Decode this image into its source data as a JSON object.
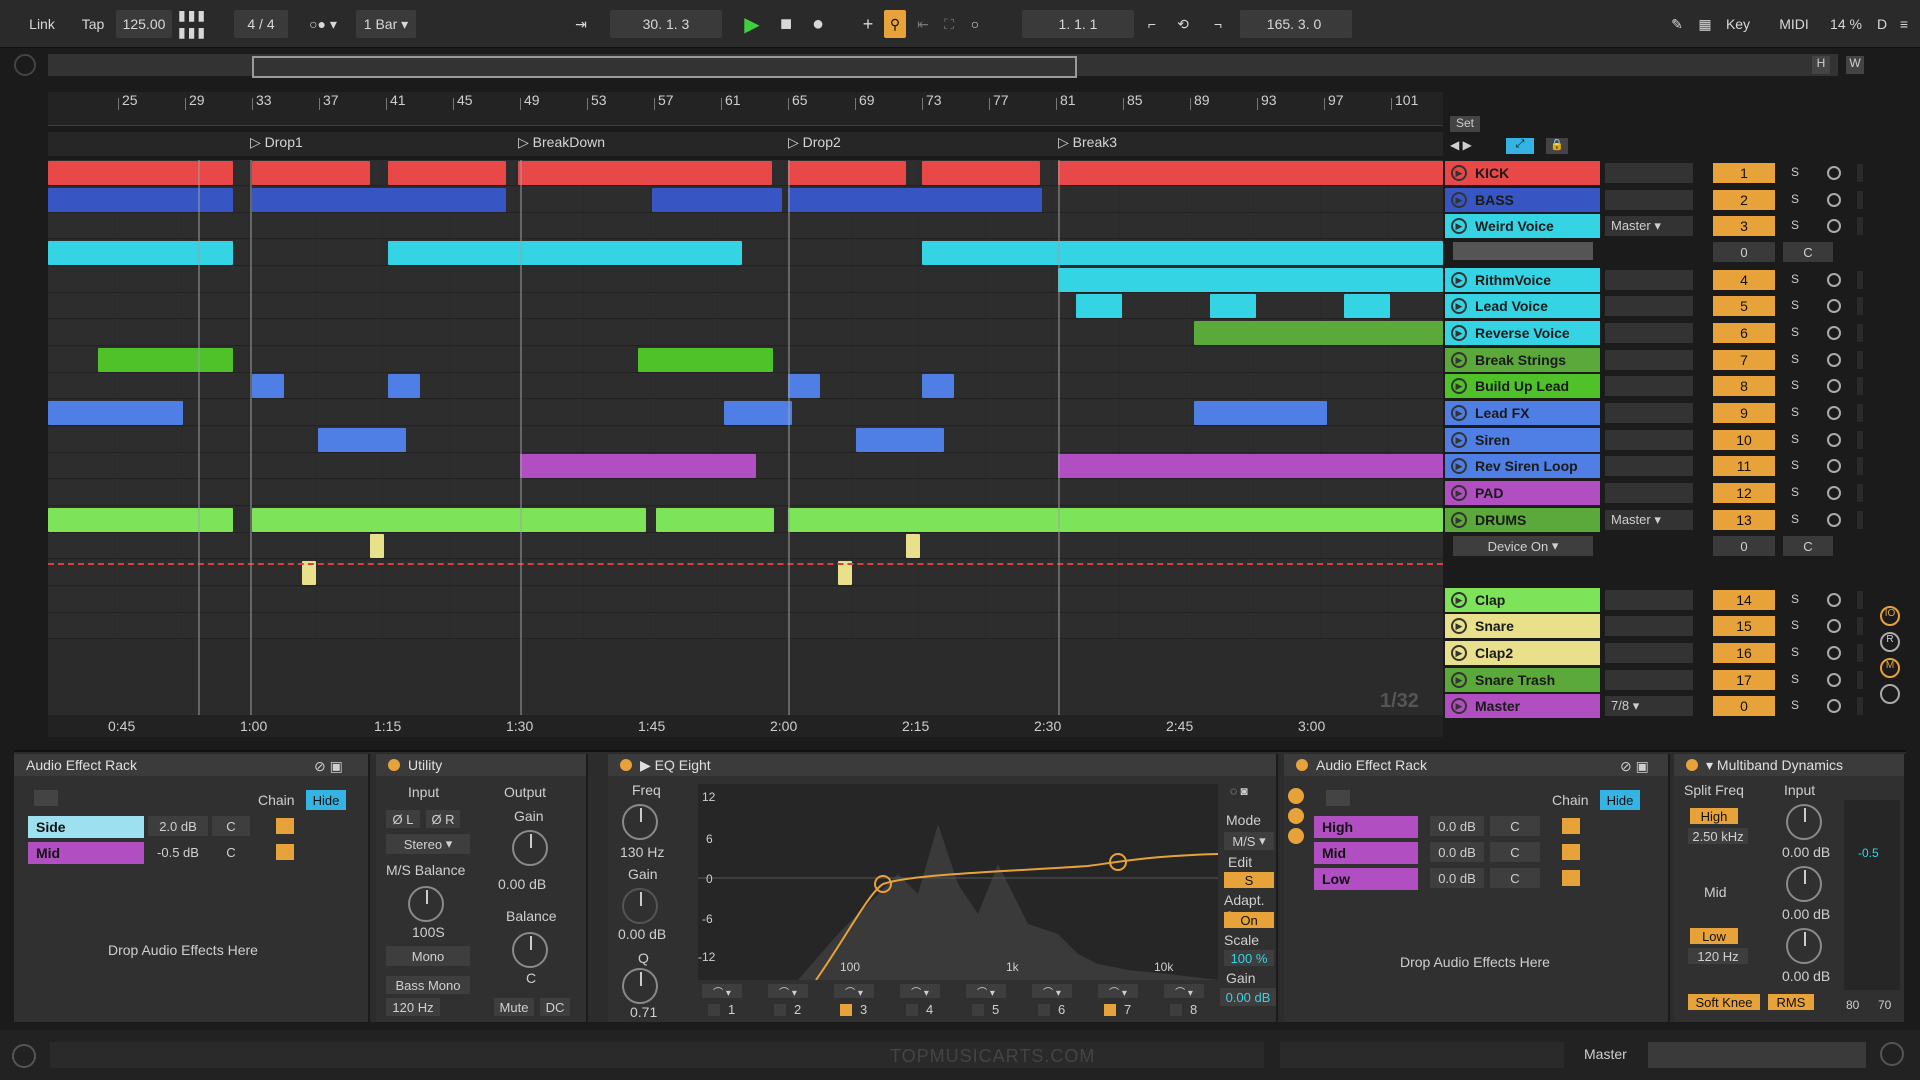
{
  "transport": {
    "link": "Link",
    "tap": "Tap",
    "tempo": "125.00",
    "signature": "4 / 4",
    "quantize": "1 Bar",
    "position": "30.  1.  3",
    "loop_start": "1.  1.  1",
    "loop_length": "165.  3.  0",
    "key": "Key",
    "midi": "MIDI",
    "cpu": "14 %",
    "d": "D"
  },
  "overview": {
    "h": "H",
    "w": "W"
  },
  "ruler": {
    "ticks": [
      "25",
      "29",
      "33",
      "37",
      "41",
      "45",
      "49",
      "53",
      "57",
      "61",
      "65",
      "69",
      "73",
      "77",
      "81",
      "85",
      "89",
      "93",
      "97",
      "101"
    ]
  },
  "locators": {
    "set": "Set",
    "items": [
      "Drop1",
      "BreakDown",
      "Drop2",
      "Break3"
    ]
  },
  "tracks": [
    {
      "name": "KICK",
      "color": "#e84848",
      "num": "1"
    },
    {
      "name": "BASS",
      "color": "#3855c4",
      "num": "2"
    },
    {
      "name": "Weird Voice",
      "color": "#35d4e4",
      "num": "3",
      "io": "Master",
      "extra_num": "0",
      "extra_pan": "C"
    },
    {
      "name": "RithmVoice",
      "color": "#35d4e4",
      "num": "4"
    },
    {
      "name": "Lead Voice",
      "color": "#35d4e4",
      "num": "5"
    },
    {
      "name": "Reverse Voice",
      "color": "#35d4e4",
      "num": "6"
    },
    {
      "name": "Break Strings",
      "color": "#5ba93a",
      "num": "7"
    },
    {
      "name": "Build Up Lead",
      "color": "#4fc22a",
      "num": "8"
    },
    {
      "name": "Lead FX",
      "color": "#4f7ee4",
      "num": "9"
    },
    {
      "name": "Siren",
      "color": "#4f7ee4",
      "num": "10"
    },
    {
      "name": "Rev Siren Loop",
      "color": "#4f7ee4",
      "num": "11"
    },
    {
      "name": "PAD",
      "color": "#b14fc2",
      "num": "12"
    },
    {
      "name": "DRUMS",
      "color": "#5ba93a",
      "num": "13",
      "io": "Master",
      "extra_num": "0",
      "extra_pan": "C",
      "device": "Device On"
    },
    {
      "name": "Clap",
      "color": "#7de45a",
      "num": "14"
    },
    {
      "name": "Snare",
      "color": "#e8e08a",
      "num": "15"
    },
    {
      "name": "Clap2",
      "color": "#e8e08a",
      "num": "16"
    },
    {
      "name": "Snare Trash",
      "color": "#5ba93a",
      "num": "17"
    },
    {
      "name": "Master",
      "color": "#b14fc2",
      "num": "0",
      "io": "7/8",
      "extra_num": "0"
    }
  ],
  "zoom_label": "1/32",
  "timeline": [
    "0:45",
    "1:00",
    "1:15",
    "1:30",
    "1:45",
    "2:00",
    "2:15",
    "2:30",
    "2:45",
    "3:00"
  ],
  "devices": {
    "rack1": {
      "title": "Audio Effect Rack",
      "chain": "Chain",
      "hide": "Hide",
      "rows": [
        {
          "name": "Side",
          "gain": "2.0 dB",
          "pan": "C"
        },
        {
          "name": "Mid",
          "gain": "-0.5 dB",
          "pan": "C"
        }
      ],
      "drop": "Drop Audio Effects Here"
    },
    "utility": {
      "title": "Utility",
      "input": "Input",
      "output": "Output",
      "l": "Ø L",
      "r": "Ø R",
      "stereo": "Stereo",
      "gain": "Gain",
      "gain_val": "0.00 dB",
      "ms": "M/S Balance",
      "ms_val": "100S",
      "balance": "Balance",
      "balance_val": "C",
      "mono": "Mono",
      "bass_mono": "Bass Mono",
      "bass_hz": "120 Hz",
      "mute": "Mute",
      "dc": "DC"
    },
    "eq": {
      "title": "EQ Eight",
      "freq": "Freq",
      "freq_val": "130 Hz",
      "gain": "Gain",
      "gain_val": "0.00 dB",
      "q": "Q",
      "q_val": "0.71",
      "db": [
        "12",
        "6",
        "0",
        "-6",
        "-12"
      ],
      "hz": [
        "100",
        "1k",
        "10k"
      ],
      "bands": [
        "1",
        "2",
        "3",
        "4",
        "5",
        "6",
        "7",
        "8"
      ],
      "mode": "Mode",
      "mode_val": "M/S",
      "edit": "Edit",
      "edit_val": "S",
      "adapt": "Adapt. Q",
      "adapt_val": "On",
      "scale": "Scale",
      "scale_val": "100 %",
      "gain2": "Gain",
      "gain2_val": "0.00 dB"
    },
    "rack2": {
      "title": "Audio Effect Rack",
      "chain": "Chain",
      "hide": "Hide",
      "rows": [
        {
          "name": "High",
          "gain": "0.0 dB",
          "pan": "C"
        },
        {
          "name": "Mid",
          "gain": "0.0 dB",
          "pan": "C"
        },
        {
          "name": "Low",
          "gain": "0.0 dB",
          "pan": "C"
        }
      ],
      "drop": "Drop Audio Effects Here"
    },
    "multiband": {
      "title": "Multiband Dynamics",
      "split": "Split Freq",
      "input": "Input",
      "high": "High",
      "high_hz": "2.50 kHz",
      "mid": "Mid",
      "low": "Low",
      "low_hz": "120 Hz",
      "db": "0.00 dB",
      "soft": "Soft Knee",
      "rms": "RMS",
      "out": "-0.5",
      "s80": "80",
      "s70": "70"
    }
  },
  "status": {
    "watermark": "TOPMUSICARTS.COM",
    "master": "Master"
  }
}
